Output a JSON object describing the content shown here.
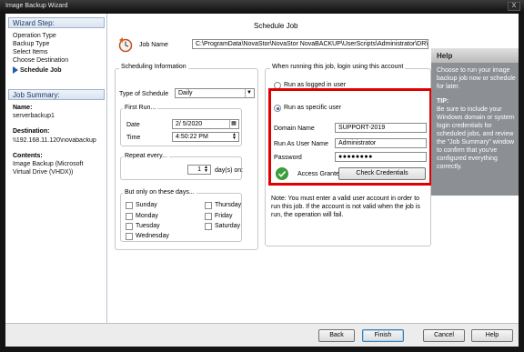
{
  "window": {
    "title": "Image Backup Wizard",
    "close_label": "X"
  },
  "wizard_steps": {
    "heading": "Wizard Step:",
    "items": [
      {
        "label": "Operation Type"
      },
      {
        "label": "Backup Type"
      },
      {
        "label": "Select Items"
      },
      {
        "label": "Choose Destination"
      },
      {
        "label": "Schedule Job",
        "active": true
      }
    ]
  },
  "job_summary": {
    "heading": "Job Summary:",
    "name_label": "Name:",
    "name_value": "serverbackup1",
    "destination_label": "Destination:",
    "destination_value": "\\\\192.168.11.120\\novabackup",
    "contents_label": "Contents:",
    "contents_value_1": "Image Backup (Microsoft",
    "contents_value_2": "Virtual Drive (VHDX))"
  },
  "main": {
    "heading": "Schedule Job",
    "job_name_label": "Job Name",
    "job_name_value": "C:\\ProgramData\\NovaStor\\NovaStor NovaBACKUP\\UserScripts\\Administrator\\DR\\serverbackup1"
  },
  "scheduling": {
    "group_title": "Scheduling Information",
    "type_label": "Type of Schedule",
    "type_value": "Daily",
    "first_run_title": "First Run...",
    "date_label": "Date",
    "date_value": "2/  5/2020",
    "time_label": "Time",
    "time_value": "4:50:22 PM",
    "repeat_title": "Repeat every...",
    "repeat_value": "1",
    "repeat_suffix": "day(s) on:",
    "days_title": "But only on these days...",
    "days": [
      "Sunday",
      "Monday",
      "Tuesday",
      "Wednesday",
      "Thursday",
      "Friday",
      "Saturday"
    ]
  },
  "login": {
    "group_title": "When running this job, login using this account",
    "radio_logged_in": "Run as logged in user",
    "radio_specific": "Run as specific user",
    "domain_label": "Domain Name",
    "domain_value": "SUPPORT-2019",
    "user_label": "Run As User Name",
    "user_value": "Administrator",
    "password_label": "Password",
    "password_value": "●●●●●●●●",
    "access_status": "Access Granted",
    "check_button": "Check Credentials",
    "note": "Note: You must enter a valid user account in order to run this job. If the account is not valid when the job is run, the operation will fail."
  },
  "help": {
    "heading": "Help",
    "text": "Choose to run your image backup job now or schedule for later.",
    "tip_heading": "TIP:",
    "tip_text": "Be sure to include your Windows domain or system login credentials for scheduled jobs, and review the \"Job Summary\" window to confirm that you've configured everything correctly."
  },
  "footer": {
    "back": "Back",
    "finish": "Finish",
    "cancel": "Cancel",
    "help": "Help"
  },
  "colors": {
    "highlight_box": "#e00000",
    "help_bg": "#8c8f94",
    "status_ok": "#3aa23a"
  }
}
